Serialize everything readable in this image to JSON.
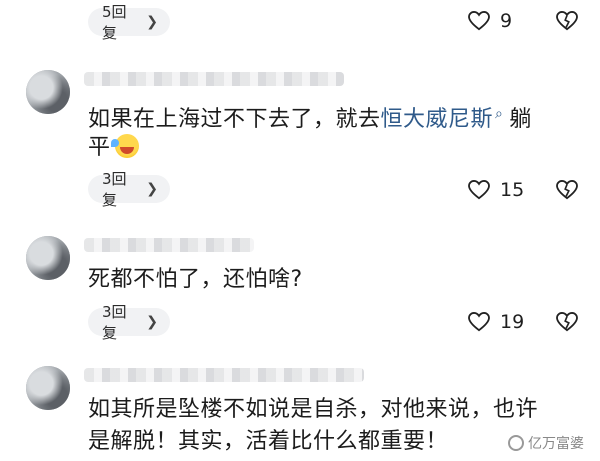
{
  "colors": {
    "text": "#1c1c1c",
    "link": "#2f5a8a",
    "pill_bg": "#f1f2f4",
    "background": "#ffffff"
  },
  "threads": [
    {
      "reply_label": "5回复",
      "likes": "9"
    },
    {
      "comment_part1": "如果在上海过不下去了，就去",
      "comment_link": "恒大威尼斯",
      "comment_part2": "躺",
      "comment_line2": "平",
      "emoji": "laughing-tears-emoji",
      "reply_label": "3回复",
      "likes": "15"
    },
    {
      "comment": "死都不怕了，还怕啥?",
      "reply_label": "3回复",
      "likes": "19"
    },
    {
      "comment_line1": "如其所是坠楼不如说是自杀，对他来说，也许",
      "comment_line2": "是解脱！其实，活着比什么都重要！"
    }
  ],
  "watermark": "亿万富婆"
}
